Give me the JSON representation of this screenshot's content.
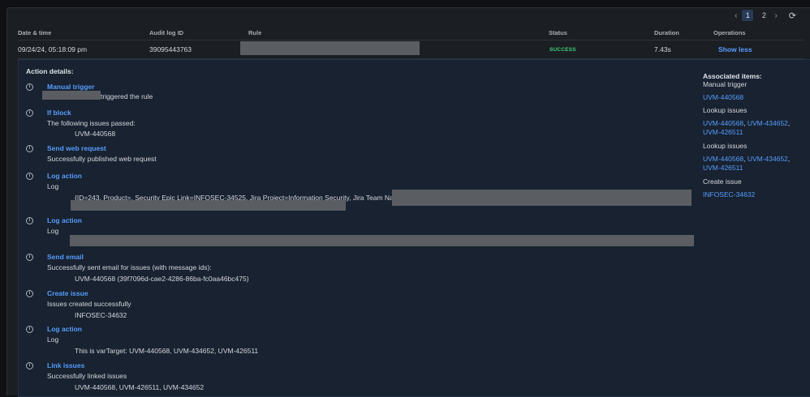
{
  "pager": {
    "pages": [
      "1",
      "2"
    ],
    "active": "1"
  },
  "table": {
    "headers": {
      "datetime": "Date & time",
      "audit_id": "Audit log ID",
      "rule": "Rule",
      "status": "Status",
      "duration": "Duration",
      "operations": "Operations"
    },
    "row": {
      "datetime": "09/24/24, 05:18:09 pm",
      "audit_id": "39095443763",
      "status": "SUCCESS",
      "duration": "7.43s",
      "operation": "Show less"
    }
  },
  "details": {
    "title": "Action details:",
    "actions": [
      {
        "title": "Manual trigger",
        "line": "triggered the rule"
      },
      {
        "title": "If block",
        "line": "The following issues passed:",
        "indent": "UVM-440568"
      },
      {
        "title": "Send web request",
        "line": "Successfully published web request"
      },
      {
        "title": "Log action",
        "line": "Log",
        "indent": "{ID=243, Product=, Security Epic Link=INFOSEC-34525, Jira Project=Information Security, Jira Team Name="
      },
      {
        "title": "Log action",
        "line": "Log"
      },
      {
        "title": "Send email",
        "line": "Successfully sent email for issues (with message ids):",
        "indent": "UVM-440568 (39f7096d-cae2-4286-86ba-fc0aa46bc475)"
      },
      {
        "title": "Create issue",
        "line": "Issues created successfully",
        "indent": "INFOSEC-34632"
      },
      {
        "title": "Log action",
        "line": "Log",
        "indent": "This is varTarget: UVM-440568, UVM-434652, UVM-426511"
      },
      {
        "title": "Link issues",
        "line": "Successfully linked issues",
        "indent": "UVM-440568, UVM-426511, UVM-434652"
      }
    ]
  },
  "associated": {
    "title": "Associated items:",
    "groups": [
      {
        "label": "Manual trigger",
        "links": [
          "UVM-440568"
        ]
      },
      {
        "label": "Lookup issues",
        "links": [
          "UVM-440568",
          "UVM-434652",
          "UVM-426511"
        ]
      },
      {
        "label": "Lookup issues",
        "links": [
          "UVM-440568",
          "UVM-434652",
          "UVM-426511"
        ]
      },
      {
        "label": "Create issue",
        "links": [
          "INFOSEC-34632"
        ]
      }
    ]
  }
}
